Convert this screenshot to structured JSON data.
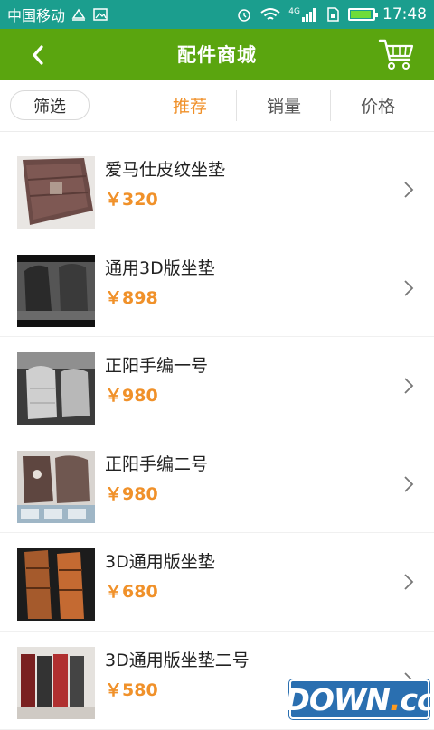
{
  "status": {
    "carrier": "中国移动",
    "network": "4G",
    "time": "17:48",
    "battery_level": 0.9
  },
  "header": {
    "title": "配件商城",
    "back_icon": "chevron-left-icon",
    "cart_icon": "cart-icon"
  },
  "filterbar": {
    "filter_label": "筛选",
    "tabs": [
      {
        "label": "推荐",
        "active": true
      },
      {
        "label": "销量",
        "active": false
      },
      {
        "label": "价格",
        "active": false
      }
    ]
  },
  "products": [
    {
      "name": "爱马仕皮纹坐垫",
      "price": "￥320"
    },
    {
      "name": "通用3D版坐垫",
      "price": "￥898"
    },
    {
      "name": "正阳手编一号",
      "price": "￥980"
    },
    {
      "name": "正阳手编二号",
      "price": "￥980"
    },
    {
      "name": "3D通用版坐垫",
      "price": "￥680"
    },
    {
      "name": "3D通用版坐垫二号",
      "price": "￥580"
    }
  ],
  "watermark": {
    "text": "DOWN",
    "dot": ".",
    "suffix": "cc"
  },
  "colors": {
    "status_bar": "#1b9e8e",
    "app_bar": "#5aa50f",
    "accent": "#f0912a"
  }
}
